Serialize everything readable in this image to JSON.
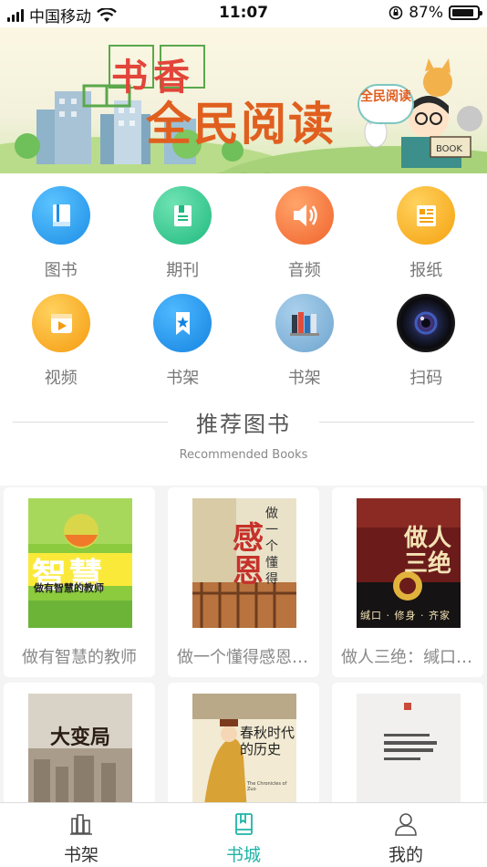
{
  "status_bar": {
    "carrier": "中国移动",
    "time": "11:07",
    "battery_percent": "87%",
    "battery_level": 0.87
  },
  "banner": {
    "title_line1": "书香",
    "title_line2": "全民阅读",
    "badge_text": "全民阅读",
    "book_label": "BOOK",
    "slide_count": 3,
    "active_slide": 0
  },
  "categories": [
    {
      "label": "图书",
      "icon": "book-icon",
      "color": "#1e9bf0"
    },
    {
      "label": "期刊",
      "icon": "journal-icon",
      "color": "#2ec98e"
    },
    {
      "label": "音频",
      "icon": "speaker-icon",
      "color": "#f4773a"
    },
    {
      "label": "报纸",
      "icon": "newspaper-icon",
      "color": "#f5a623"
    },
    {
      "label": "视频",
      "icon": "video-icon",
      "color": "#f5a623"
    },
    {
      "label": "书架",
      "icon": "bookmark-icon",
      "color": "#1e9bf0"
    },
    {
      "label": "书架",
      "icon": "bookshelf-icon",
      "color": "#7fb2d8"
    },
    {
      "label": "扫码",
      "icon": "camera-lens-icon",
      "color": "#111111"
    }
  ],
  "recommended": {
    "title": "推荐图书",
    "subtitle": "Recommended Books",
    "books": [
      {
        "title": "做有智慧的教师",
        "cover_text_main": "智慧",
        "cover_text_sub": "做有智慧的教师"
      },
      {
        "title": "做一个懂得感恩的人",
        "cover_text_main": "感恩",
        "cover_text_sub": "做一个懂得"
      },
      {
        "title": "做人三绝：缄口·修身·齐家",
        "cover_text_main": "做人三绝",
        "cover_text_sub": "缄口 · 修身 · 齐家"
      },
      {
        "title": "大变局",
        "cover_text_main": "大变局",
        "cover_text_sub": ""
      },
      {
        "title": "春秋时代的历史",
        "cover_text_main": "春秋时代的历史",
        "cover_text_sub": "The Chronicles of Zuo"
      },
      {
        "title": "",
        "cover_text_main": "",
        "cover_text_sub": ""
      }
    ]
  },
  "tabs": [
    {
      "label": "书架",
      "icon": "bookshelf-tab-icon",
      "active": false
    },
    {
      "label": "书城",
      "icon": "book-store-tab-icon",
      "active": true
    },
    {
      "label": "我的",
      "icon": "user-tab-icon",
      "active": false
    }
  ],
  "colors": {
    "accent": "#1fb4a7",
    "text_muted": "#888888",
    "background": "#f4f4f4"
  }
}
